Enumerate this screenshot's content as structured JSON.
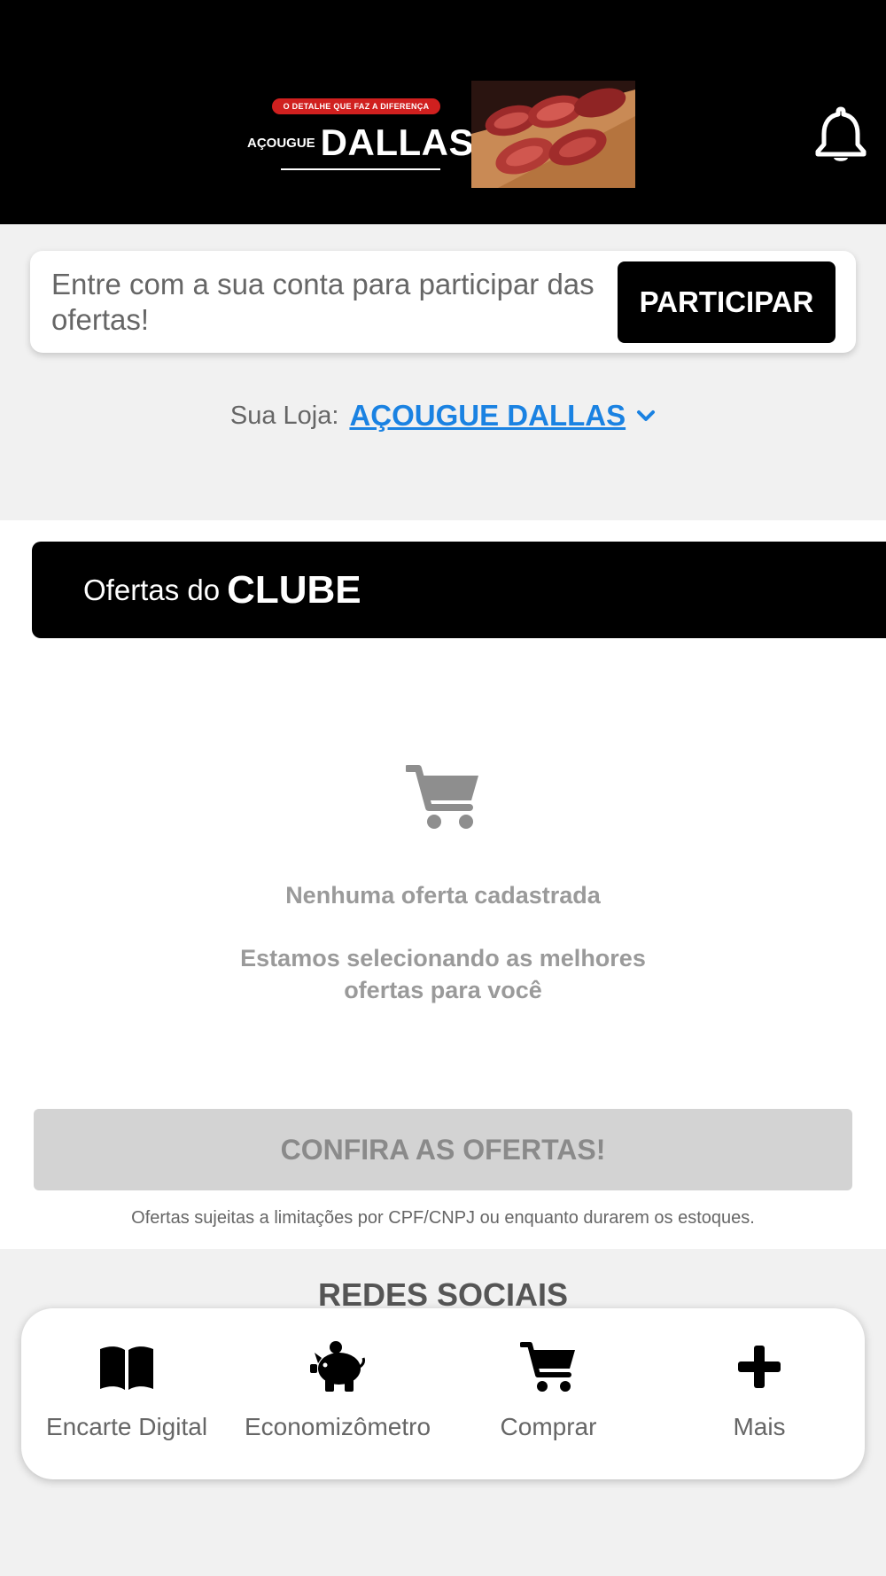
{
  "header": {
    "logo_tagline": "O DETALHE QUE FAZ A DIFERENÇA",
    "logo_prefix": "AÇOUGUE",
    "logo_name": "DALLAS",
    "notification_icon": "bell-icon"
  },
  "login": {
    "text": "Entre com a sua conta para participar das ofertas!",
    "button_label": "PARTICIPAR"
  },
  "store": {
    "label": "Sua Loja:",
    "name": "AÇOUGUE DALLAS",
    "chevron_icon": "chevron-down-icon",
    "link_color": "#1a82e2"
  },
  "club": {
    "prefix": "Ofertas do",
    "title": "CLUBE"
  },
  "empty_state": {
    "icon": "cart-icon",
    "title": "Nenhuma oferta cadastrada",
    "subtitle": "Estamos selecionando as melhores ofertas para você"
  },
  "offers_button": {
    "label": "CONFIRA AS OFERTAS!"
  },
  "disclaimer": "Ofertas sujeitas a limitações por CPF/CNPJ ou enquanto durarem os estoques.",
  "social": {
    "title": "REDES SOCIAIS"
  },
  "bottom_nav": {
    "items": [
      {
        "label": "Encarte Digital",
        "icon": "book-icon"
      },
      {
        "label": "Economizômetro",
        "icon": "piggy-bank-icon"
      },
      {
        "label": "Comprar",
        "icon": "cart-icon"
      },
      {
        "label": "Mais",
        "icon": "plus-icon"
      }
    ]
  }
}
